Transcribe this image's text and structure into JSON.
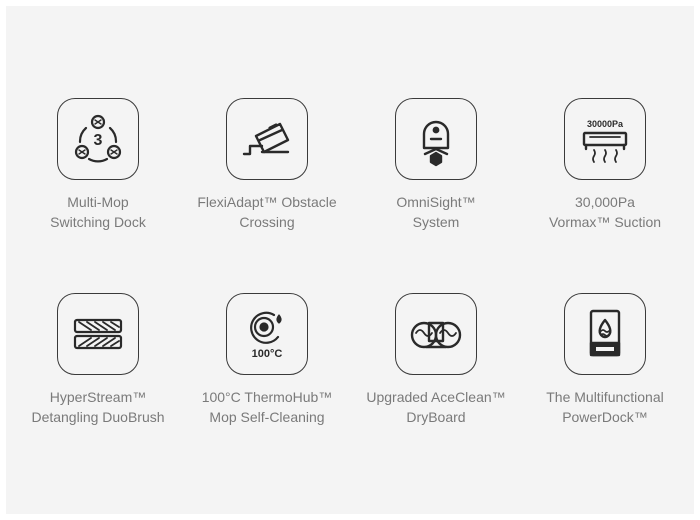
{
  "features": [
    {
      "icon": "multi-mop-dock-icon",
      "icon_text": "3",
      "line1": "Multi-Mop",
      "line2": "Switching Dock"
    },
    {
      "icon": "obstacle-crossing-icon",
      "line1": "FlexiAdapt™ Obstacle",
      "line2": "Crossing"
    },
    {
      "icon": "omnisight-robot-icon",
      "line1": "OmniSight™",
      "line2": "System"
    },
    {
      "icon": "suction-power-icon",
      "icon_text": "30000Pa",
      "line1": "30,000Pa",
      "line2": "Vormax™ Suction"
    },
    {
      "icon": "duobrush-icon",
      "line1": "HyperStream™",
      "line2": "Detangling DuoBrush"
    },
    {
      "icon": "thermohub-icon",
      "icon_text": "100°C",
      "line1": "100°C ThermoHub™",
      "line2": "Mop Self-Cleaning"
    },
    {
      "icon": "dryboard-icon",
      "line1": "Upgraded AceClean™",
      "line2": "DryBoard"
    },
    {
      "icon": "powerdock-icon",
      "line1": "The Multifunctional",
      "line2": "PowerDock™"
    }
  ],
  "colors": {
    "panel": "#f4f4f4",
    "icon_stroke": "#3a3a3a",
    "label": "#7a7a7a"
  }
}
